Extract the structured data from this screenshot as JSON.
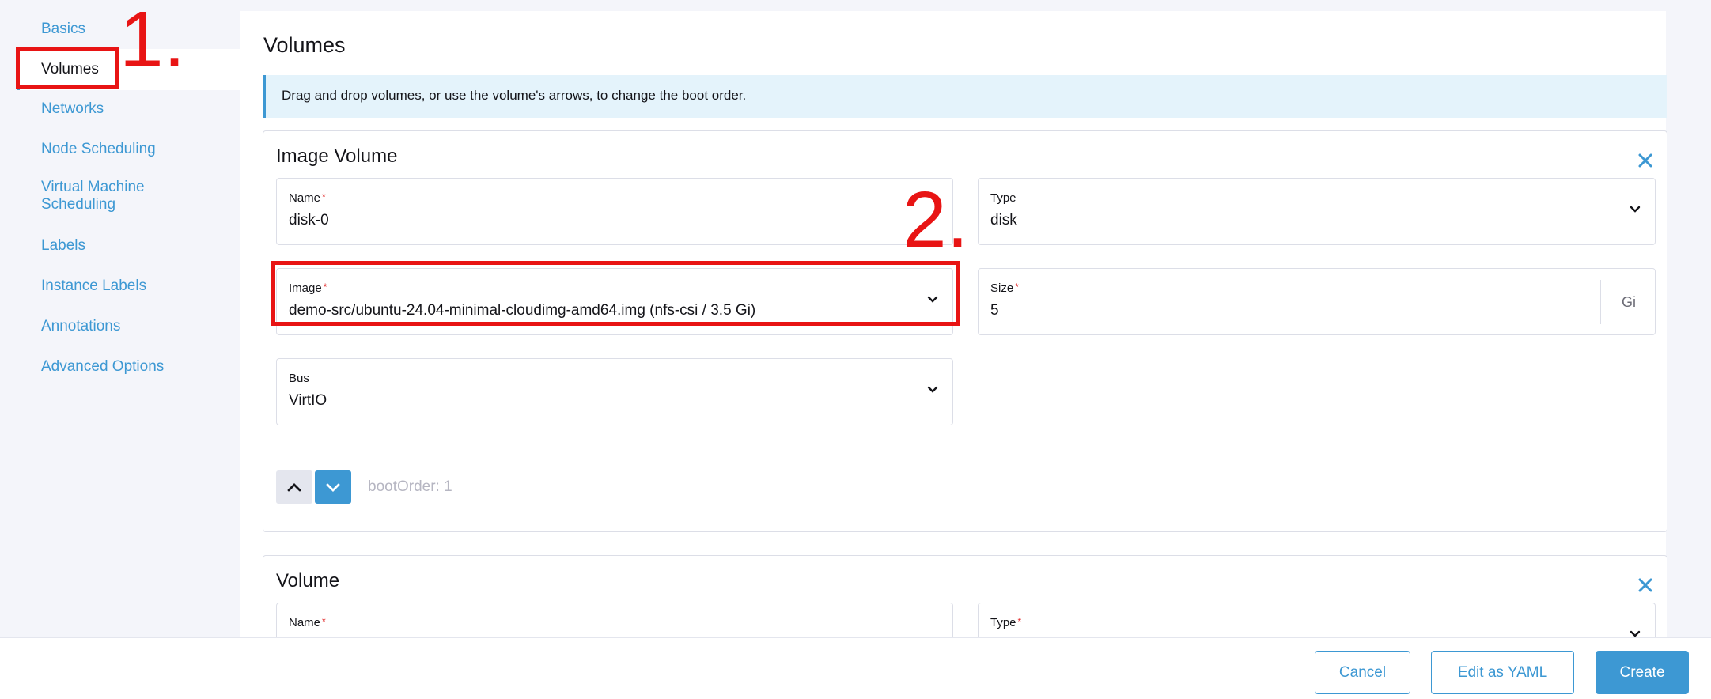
{
  "nav": {
    "items": [
      {
        "label": "Basics"
      },
      {
        "label": "Volumes"
      },
      {
        "label": "Networks"
      },
      {
        "label": "Node Scheduling"
      },
      {
        "label": "Virtual Machine Scheduling"
      },
      {
        "label": "Labels"
      },
      {
        "label": "Instance Labels"
      },
      {
        "label": "Annotations"
      },
      {
        "label": "Advanced Options"
      }
    ],
    "active": "Volumes"
  },
  "section": {
    "title": "Volumes",
    "banner": "Drag and drop volumes, or use the volume's arrows, to change the boot order."
  },
  "image_volume": {
    "title": "Image Volume",
    "name_label": "Name",
    "name_value": "disk-0",
    "type_label": "Type",
    "type_value": "disk",
    "image_label": "Image",
    "image_value": "demo-src/ubuntu-24.04-minimal-cloudimg-amd64.img (nfs-csi / 3.5 Gi)",
    "size_label": "Size",
    "size_value": "5",
    "size_unit": "Gi",
    "bus_label": "Bus",
    "bus_value": "VirtIO",
    "boot_order": "bootOrder: 1"
  },
  "volume": {
    "title": "Volume",
    "name_label": "Name",
    "type_label": "Type"
  },
  "required_mark": "*",
  "footer": {
    "cancel": "Cancel",
    "edit_yaml": "Edit as YAML",
    "create": "Create"
  },
  "annotations": {
    "step1": "1.",
    "step2": "2."
  },
  "colors": {
    "accent": "#3d98d3",
    "annotation": "#e81414",
    "banner_bg": "#e4f3fb"
  }
}
